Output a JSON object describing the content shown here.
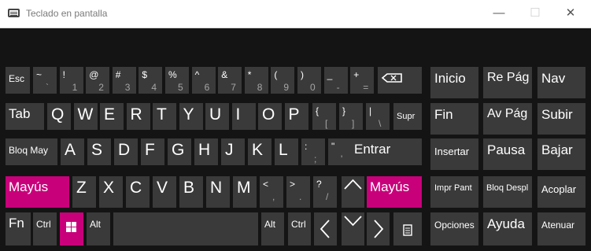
{
  "window": {
    "title": "Teclado en pantalla"
  },
  "keys": {
    "esc": "Esc",
    "tab": "Tab",
    "bloq_may": "Bloq May",
    "mayus_left": "Mayús",
    "mayus_right": "Mayús",
    "fn": "Fn",
    "ctrl_left": "Ctrl",
    "alt_left": "Alt",
    "alt_right": "Alt",
    "ctrl_right": "Ctrl",
    "supr": "Supr",
    "entrar": "Entrar",
    "row1": [
      {
        "top": "~",
        "bot": "`"
      },
      {
        "top": "!",
        "bot": "1"
      },
      {
        "top": "@",
        "bot": "2"
      },
      {
        "top": "#",
        "bot": "3"
      },
      {
        "top": "$",
        "bot": "4"
      },
      {
        "top": "%",
        "bot": "5"
      },
      {
        "top": "^",
        "bot": "6"
      },
      {
        "top": "&",
        "bot": "7"
      },
      {
        "top": "*",
        "bot": "8"
      },
      {
        "top": "(",
        "bot": "9"
      },
      {
        "top": ")",
        "bot": "0"
      },
      {
        "top": "_",
        "bot": "-"
      },
      {
        "top": "+",
        "bot": "="
      }
    ],
    "row2_letters": [
      "Q",
      "W",
      "E",
      "R",
      "T",
      "Y",
      "U",
      "I",
      "O",
      "P"
    ],
    "row2_syms": [
      {
        "top": "{",
        "bot": "["
      },
      {
        "top": "}",
        "bot": "]"
      },
      {
        "top": "|",
        "bot": "\\"
      }
    ],
    "row3_letters": [
      "A",
      "S",
      "D",
      "F",
      "G",
      "H",
      "J",
      "K",
      "L"
    ],
    "row3_syms": [
      {
        "top": ":",
        "bot": ";"
      },
      {
        "top": "\"",
        "bot": "'"
      }
    ],
    "row4_letters": [
      "Z",
      "X",
      "C",
      "V",
      "B",
      "N",
      "M"
    ],
    "row4_syms": [
      {
        "top": "<",
        "bot": ","
      },
      {
        "top": ">",
        "bot": "."
      },
      {
        "top": "?",
        "bot": "/"
      }
    ]
  },
  "nav": {
    "inicio": "Inicio",
    "re_pag": "Re Pág",
    "nav": "Nav",
    "fin": "Fin",
    "av_pag": "Av Pág",
    "subir": "Subir",
    "insertar": "Insertar",
    "pausa": "Pausa",
    "bajar": "Bajar",
    "impr_pant": "Impr Pant",
    "bloq_despl": "Bloq Despl",
    "acoplar": "Acoplar",
    "opciones": "Opciones",
    "ayuda": "Ayuda",
    "atenuar": "Atenuar"
  },
  "colors": {
    "accent": "#c8007a",
    "key": "#3a3a3a",
    "background": "#141414"
  }
}
